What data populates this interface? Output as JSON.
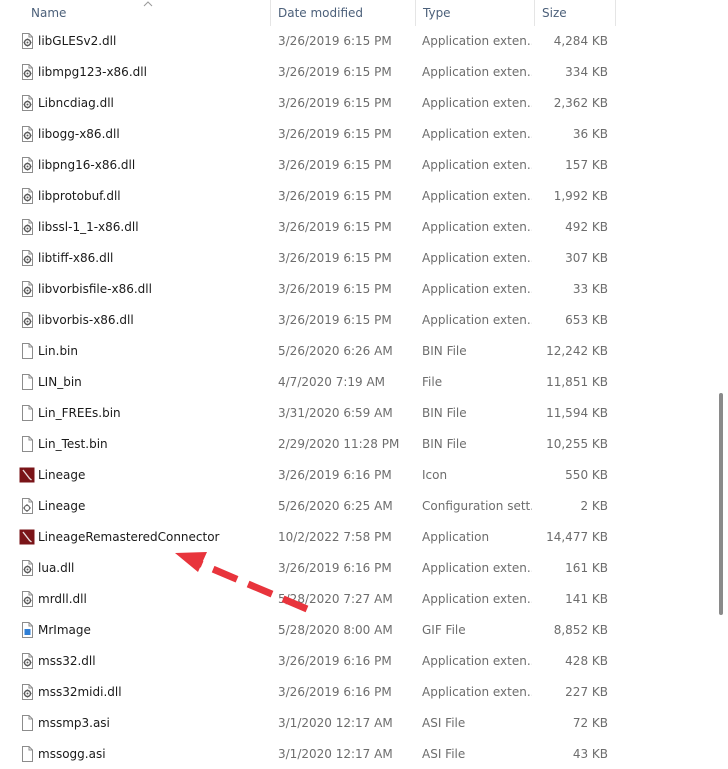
{
  "columns": {
    "name": "Name",
    "date": "Date modified",
    "type": "Type",
    "size": "Size"
  },
  "files": [
    {
      "name": "libGLESv2.dll",
      "date": "3/26/2019 6:15 PM",
      "type": "Application exten...",
      "size": "4,284 KB",
      "icon": "dll-gear-icon"
    },
    {
      "name": "libmpg123-x86.dll",
      "date": "3/26/2019 6:15 PM",
      "type": "Application exten...",
      "size": "334 KB",
      "icon": "dll-gear-icon"
    },
    {
      "name": "Libncdiag.dll",
      "date": "3/26/2019 6:15 PM",
      "type": "Application exten...",
      "size": "2,362 KB",
      "icon": "dll-gear-icon"
    },
    {
      "name": "libogg-x86.dll",
      "date": "3/26/2019 6:15 PM",
      "type": "Application exten...",
      "size": "36 KB",
      "icon": "dll-gear-icon"
    },
    {
      "name": "libpng16-x86.dll",
      "date": "3/26/2019 6:15 PM",
      "type": "Application exten...",
      "size": "157 KB",
      "icon": "dll-gear-icon"
    },
    {
      "name": "libprotobuf.dll",
      "date": "3/26/2019 6:15 PM",
      "type": "Application exten...",
      "size": "1,992 KB",
      "icon": "dll-gear-icon"
    },
    {
      "name": "libssl-1_1-x86.dll",
      "date": "3/26/2019 6:15 PM",
      "type": "Application exten...",
      "size": "492 KB",
      "icon": "dll-gear-icon"
    },
    {
      "name": "libtiff-x86.dll",
      "date": "3/26/2019 6:15 PM",
      "type": "Application exten...",
      "size": "307 KB",
      "icon": "dll-gear-icon"
    },
    {
      "name": "libvorbisfile-x86.dll",
      "date": "3/26/2019 6:15 PM",
      "type": "Application exten...",
      "size": "33 KB",
      "icon": "dll-gear-icon"
    },
    {
      "name": "libvorbis-x86.dll",
      "date": "3/26/2019 6:15 PM",
      "type": "Application exten...",
      "size": "653 KB",
      "icon": "dll-gear-icon"
    },
    {
      "name": "Lin.bin",
      "date": "5/26/2020 6:26 AM",
      "type": "BIN File",
      "size": "12,242 KB",
      "icon": "blank-file-icon"
    },
    {
      "name": "LIN_bin",
      "date": "4/7/2020 7:19 AM",
      "type": "File",
      "size": "11,851 KB",
      "icon": "blank-file-icon"
    },
    {
      "name": "Lin_FREEs.bin",
      "date": "3/31/2020 6:59 AM",
      "type": "BIN File",
      "size": "11,594 KB",
      "icon": "blank-file-icon"
    },
    {
      "name": "Lin_Test.bin",
      "date": "2/29/2020 11:28 PM",
      "type": "BIN File",
      "size": "10,255 KB",
      "icon": "blank-file-icon"
    },
    {
      "name": "Lineage",
      "date": "3/26/2019 6:16 PM",
      "type": "Icon",
      "size": "550 KB",
      "icon": "lineage-app-icon"
    },
    {
      "name": "Lineage",
      "date": "5/26/2020 6:25 AM",
      "type": "Configuration sett...",
      "size": "2 KB",
      "icon": "config-file-icon"
    },
    {
      "name": "LineageRemasteredConnector",
      "date": "10/2/2022 7:58 PM",
      "type": "Application",
      "size": "14,477 KB",
      "icon": "lineage-app-icon"
    },
    {
      "name": "lua.dll",
      "date": "3/26/2019 6:16 PM",
      "type": "Application exten...",
      "size": "161 KB",
      "icon": "dll-gear-icon"
    },
    {
      "name": "mrdll.dll",
      "date": "5/28/2020 7:27 AM",
      "type": "Application exten...",
      "size": "141 KB",
      "icon": "dll-gear-icon"
    },
    {
      "name": "MrImage",
      "date": "5/28/2020 8:00 AM",
      "type": "GIF File",
      "size": "8,852 KB",
      "icon": "gif-image-icon"
    },
    {
      "name": "mss32.dll",
      "date": "3/26/2019 6:16 PM",
      "type": "Application exten...",
      "size": "428 KB",
      "icon": "dll-gear-icon"
    },
    {
      "name": "mss32midi.dll",
      "date": "3/26/2019 6:16 PM",
      "type": "Application exten...",
      "size": "227 KB",
      "icon": "dll-gear-icon"
    },
    {
      "name": "mssmp3.asi",
      "date": "3/1/2020 12:17 AM",
      "type": "ASI File",
      "size": "72 KB",
      "icon": "blank-file-icon"
    },
    {
      "name": "mssogg.asi",
      "date": "3/1/2020 12:17 AM",
      "type": "ASI File",
      "size": "43 KB",
      "icon": "blank-file-icon"
    }
  ],
  "colors": {
    "header_text": "#4c607a",
    "secondary_text": "#6d6d6d",
    "lineage_icon": "#7a1418",
    "annotation_arrow": "#e8343c"
  }
}
